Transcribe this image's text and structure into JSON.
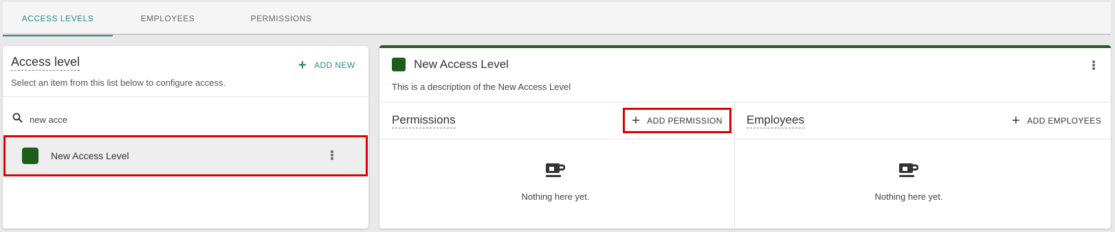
{
  "tabs": [
    {
      "label": "ACCESS LEVELS",
      "active": true
    },
    {
      "label": "EMPLOYEES",
      "active": false
    },
    {
      "label": "PERMISSIONS",
      "active": false
    }
  ],
  "left_panel": {
    "title": "Access level",
    "subtitle": "Select an item from this list below to configure access.",
    "add_new_label": "ADD NEW",
    "search": {
      "value": "new acce",
      "icon": "search-icon"
    },
    "items": [
      {
        "label": "New Access Level",
        "color": "#1e5c1e",
        "selected": true
      }
    ]
  },
  "detail": {
    "title": "New Access Level",
    "color": "#1e5c1e",
    "description": "This is a description of the New Access Level",
    "permissions": {
      "title": "Permissions",
      "add_label": "ADD PERMISSION",
      "empty_text": "Nothing here yet."
    },
    "employees": {
      "title": "Employees",
      "add_label": "ADD EMPLOYEES",
      "empty_text": "Nothing here yet."
    }
  },
  "colors": {
    "accent": "#2a8a8a",
    "level_green": "#1e5c1e",
    "highlight_red": "#dd0000"
  }
}
